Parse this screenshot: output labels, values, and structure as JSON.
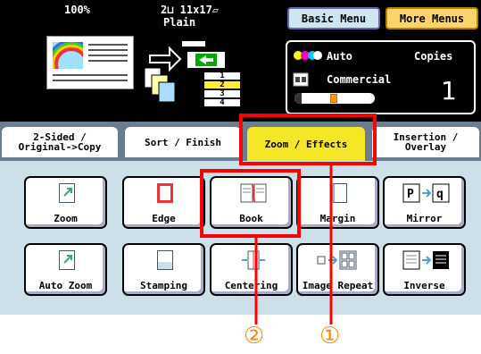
{
  "status": {
    "zoom": "100%",
    "paper": "2⊔ 11x17▱",
    "paper_type": "Plain"
  },
  "header": {
    "basic_menu": "Basic Menu",
    "more_menus": "More Menus"
  },
  "settings_panel": {
    "color_mode": "Auto",
    "copies_label": "Copies",
    "copies_value": "1",
    "mode": "Commercial"
  },
  "trays": [
    "1",
    "2",
    "3",
    "4"
  ],
  "tabs": [
    {
      "label": "2-Sided /\nOriginal->Copy"
    },
    {
      "label": "Sort / Finish"
    },
    {
      "label": "Zoom / Effects"
    },
    {
      "label": "Insertion /\nOverlay"
    }
  ],
  "functions": [
    "Zoom",
    "Edge",
    "Book",
    "Margin",
    "Mirror",
    "Auto Zoom",
    "Stamping",
    "Centering",
    "Image Repeat",
    "Inverse"
  ],
  "mirror_letters": [
    "P",
    "q"
  ],
  "callouts": [
    "②",
    "①"
  ],
  "colors": {
    "selected_tab": "#f5e628",
    "more_menus": "#ffd36b",
    "basic_menu": "#cfe6f2",
    "callout": "#ff0000",
    "number": "#ff8800"
  }
}
